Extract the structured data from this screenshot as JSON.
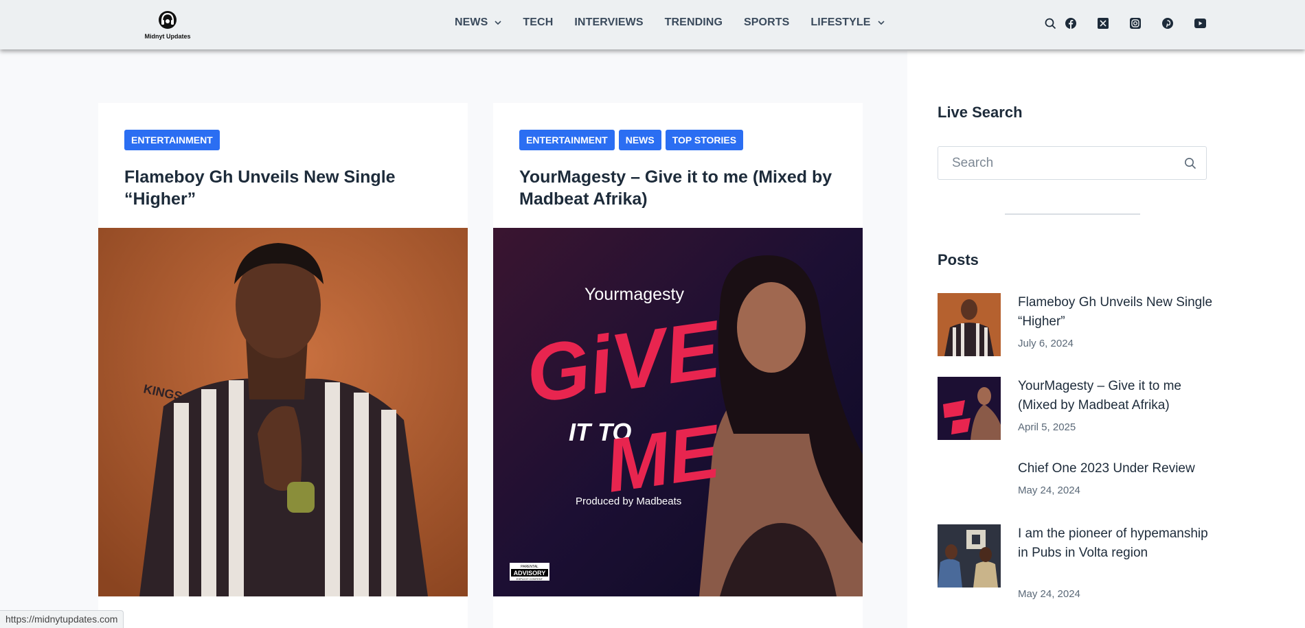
{
  "header": {
    "logo_text": "Midnyt Updates",
    "nav": [
      {
        "label": "NEWS",
        "dropdown": true
      },
      {
        "label": "TECH",
        "dropdown": false
      },
      {
        "label": "INTERVIEWS",
        "dropdown": false
      },
      {
        "label": "TRENDING",
        "dropdown": false
      },
      {
        "label": "SPORTS",
        "dropdown": false
      },
      {
        "label": "LIFESTYLE",
        "dropdown": true
      }
    ],
    "icons": [
      "search-icon",
      "facebook-icon",
      "x-twitter-icon",
      "instagram-icon",
      "pinterest-icon",
      "youtube-icon"
    ]
  },
  "cards": [
    {
      "badges": [
        "ENTERTAINMENT"
      ],
      "title": "Flameboy Gh Unveils New Single “Higher”",
      "image": "artist-portrait-photo"
    },
    {
      "badges": [
        "ENTERTAINMENT",
        "NEWS",
        "TOP STORIES"
      ],
      "title": "YourMagesty – Give it to me (Mixed by Madbeat Afrika)",
      "image": "single-cover-art",
      "cover": {
        "artist": "Yourmagesty",
        "title_big": "GiVE",
        "title_small": "IT TO",
        "title_end": "ME",
        "credit": "Produced by Madbeats",
        "advisory_top": "PARENTAL",
        "advisory_main": "ADVISORY",
        "advisory_bottom": "EXPLICIT CONTENT"
      }
    }
  ],
  "sidebar": {
    "live_search_heading": "Live Search",
    "search_placeholder": "Search",
    "posts_heading": "Posts",
    "posts": [
      {
        "title": "Flameboy Gh Unveils New Single “Higher”",
        "date": "July 6, 2024"
      },
      {
        "title": "YourMagesty – Give it to me (Mixed by Madbeat Afrika)",
        "date": "April 5, 2025"
      },
      {
        "title": "Chief One 2023 Under Review",
        "date": "May 24, 2024"
      },
      {
        "title": "I am the pioneer of hypemanship in Pubs in Volta region",
        "date": "May 24, 2024"
      }
    ]
  },
  "status_bar": {
    "url": "https://midnytupdates.com"
  },
  "colors": {
    "accent": "#2b6ef2",
    "header_bg": "#edf0f2",
    "page_bg": "#f8f9fb"
  }
}
